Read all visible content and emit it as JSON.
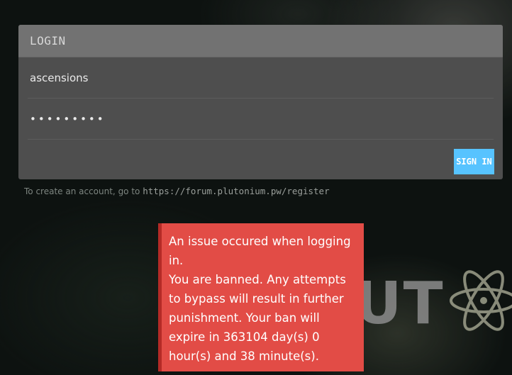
{
  "login": {
    "header": "LOGIN",
    "username_value": "ascensions",
    "password_masked": "•••••••••",
    "signin_label": "SIGN IN"
  },
  "register_note": {
    "prefix": "To create an account, go to ",
    "url": "https://forum.plutonium.pw/register"
  },
  "error": {
    "line1": "An issue occured when logging in.",
    "line2": "You are banned. Any attempts to bypass will result in further punishment. Your ban will expire in 363104 day(s) 0 hour(s) and 38 minute(s)."
  },
  "background": {
    "logo_text": "UT"
  },
  "colors": {
    "accent": "#57c3ff",
    "error": "#e24c46"
  }
}
